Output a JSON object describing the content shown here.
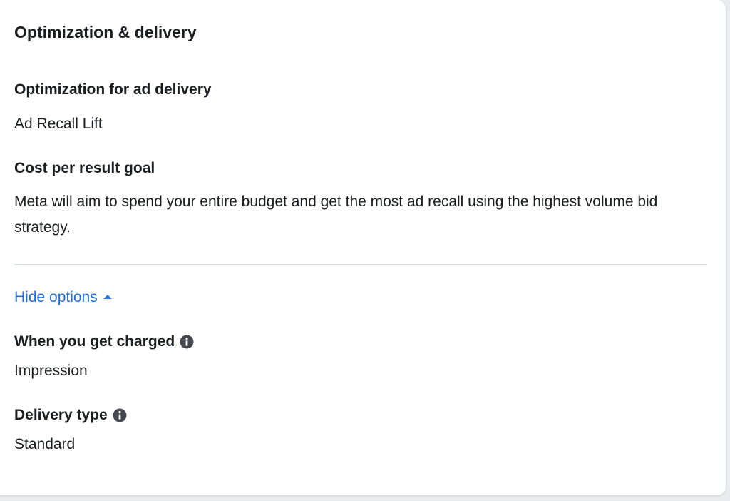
{
  "card": {
    "title": "Optimization & delivery"
  },
  "optimization": {
    "label": "Optimization for ad delivery",
    "value": "Ad Recall Lift"
  },
  "cost_goal": {
    "label": "Cost per result goal",
    "description": "Meta will aim to spend your entire budget and get the most ad recall using the highest volume bid strategy."
  },
  "options_toggle": {
    "label": "Hide options",
    "icon": "caret-up-icon"
  },
  "charged": {
    "label": "When you get charged",
    "value": "Impression",
    "icon": "info-icon"
  },
  "delivery_type": {
    "label": "Delivery type",
    "value": "Standard",
    "icon": "info-icon"
  },
  "colors": {
    "link": "#216fdb",
    "text": "#1c1e21",
    "divider": "#dadde1",
    "info_icon": "#444950"
  }
}
